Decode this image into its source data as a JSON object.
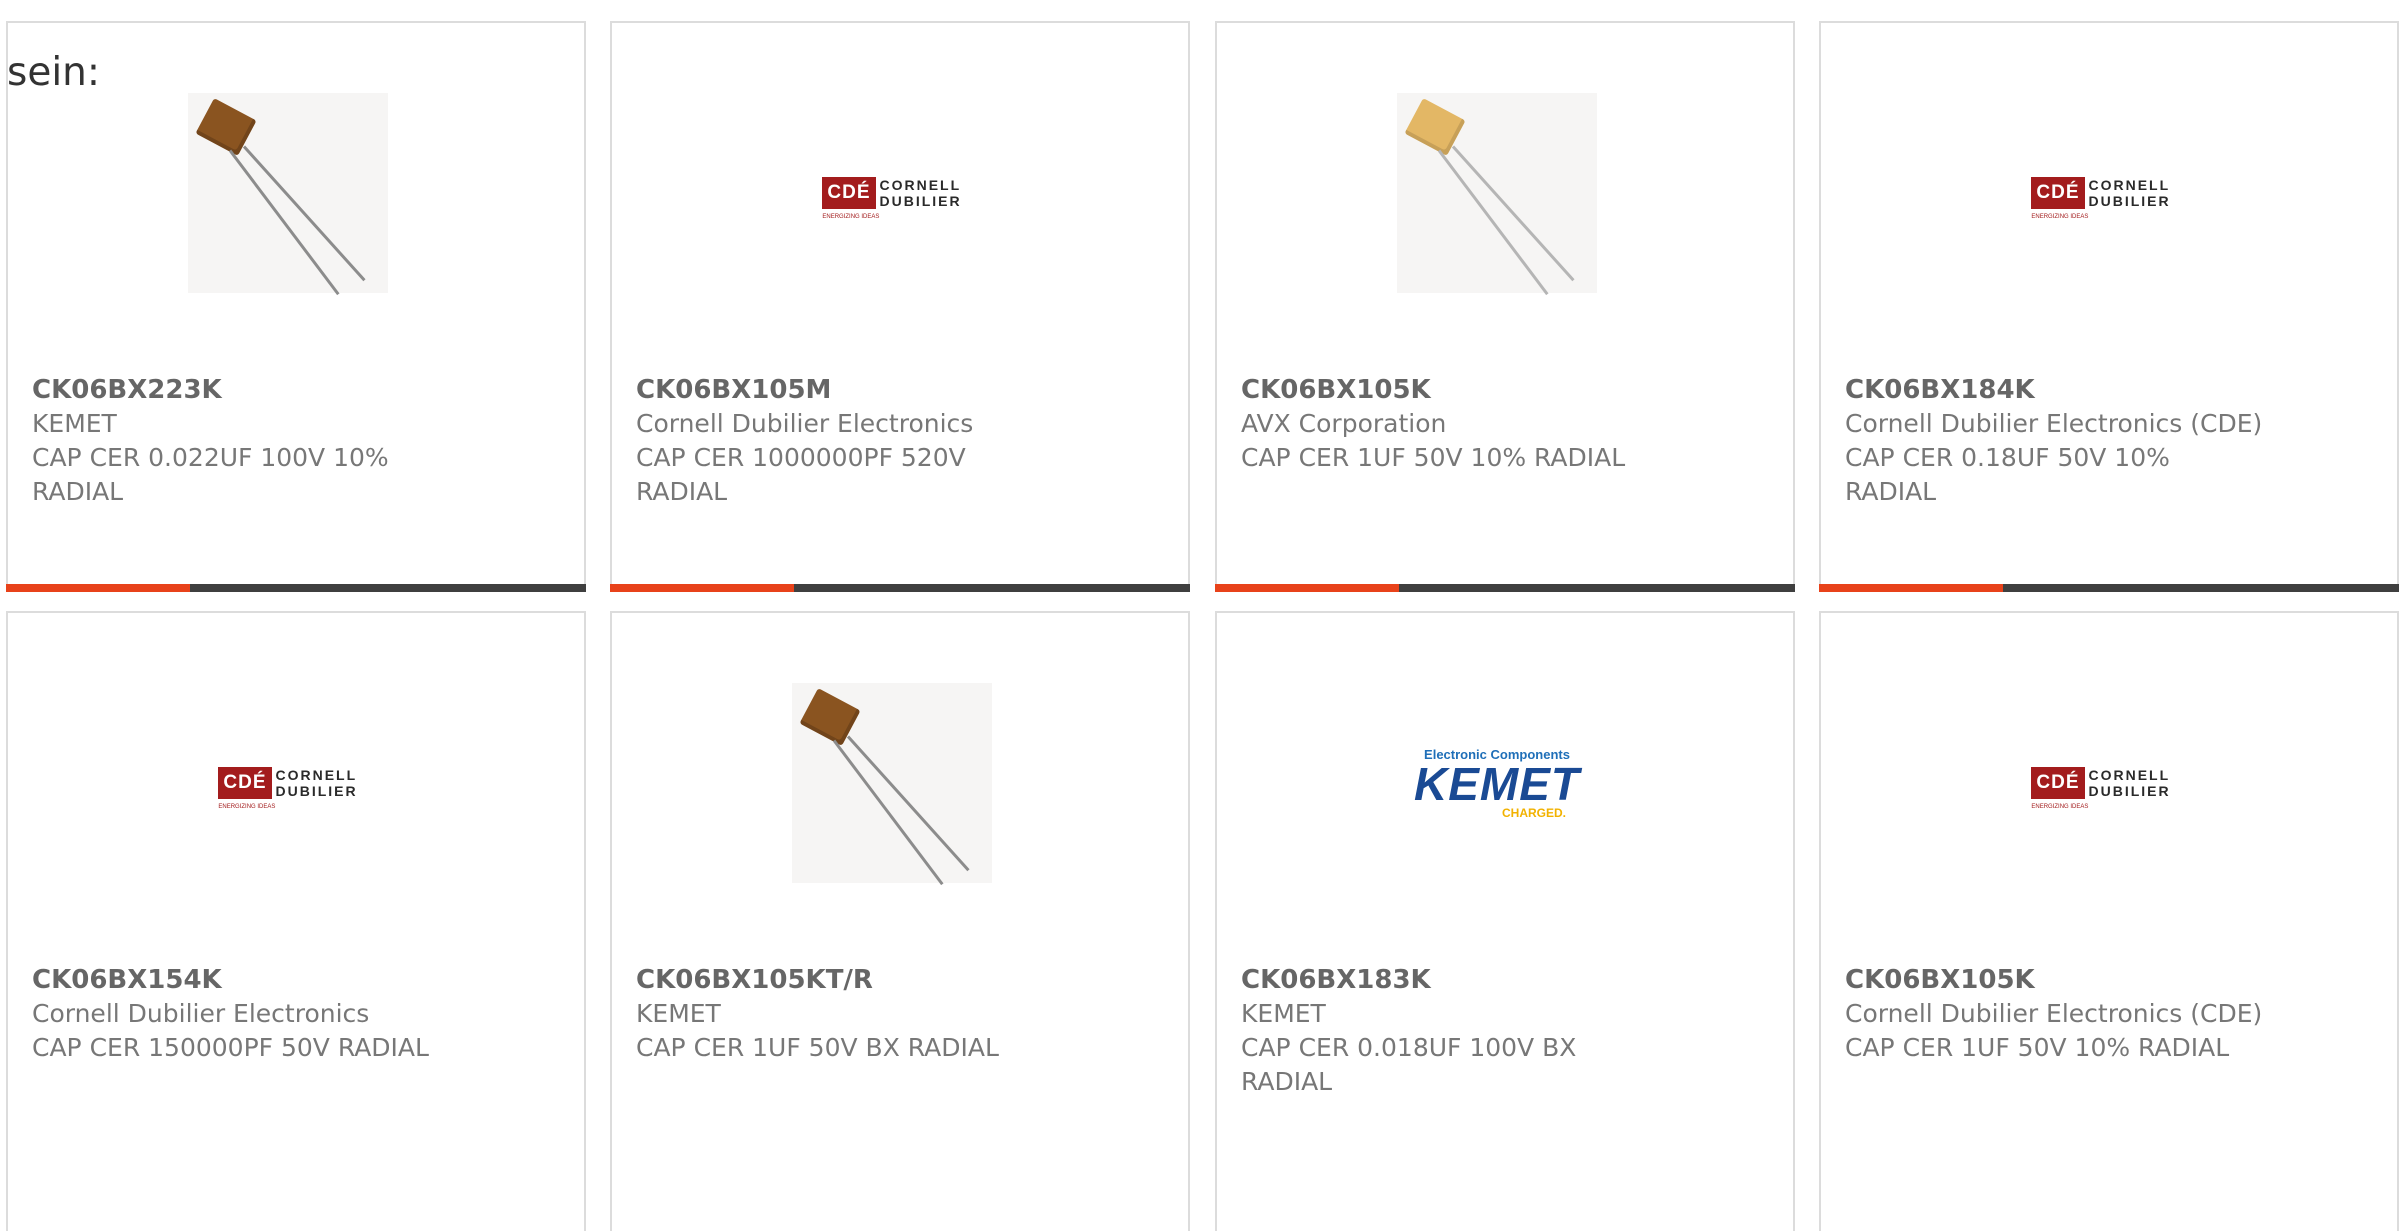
{
  "intro_text": "sein:",
  "accent_color": "#e8421a",
  "products": [
    {
      "part": "CK06BX223K",
      "manufacturer": "KEMET",
      "description": "CAP CER 0.022UF 100V 10% RADIAL",
      "image": "brown-capacitor-photo"
    },
    {
      "part": "CK06BX105M",
      "manufacturer": "Cornell Dubilier Electronics",
      "description": "CAP CER 1000000PF 520V RADIAL",
      "image": "cde-logo"
    },
    {
      "part": "CK06BX105K",
      "manufacturer": "AVX Corporation",
      "description": "CAP CER 1UF 50V 10% RADIAL",
      "image": "yellow-capacitor-photo"
    },
    {
      "part": "CK06BX184K",
      "manufacturer": "Cornell Dubilier Electronics (CDE)",
      "description": "CAP CER 0.18UF 50V 10% RADIAL",
      "image": "cde-logo"
    },
    {
      "part": "CK06BX154K",
      "manufacturer": "Cornell Dubilier Electronics",
      "description": "CAP CER 150000PF 50V RADIAL",
      "image": "cde-logo"
    },
    {
      "part": "CK06BX105KT/R",
      "manufacturer": "KEMET",
      "description": "CAP CER 1UF 50V BX RADIAL",
      "image": "brown-capacitor-photo"
    },
    {
      "part": "CK06BX183K",
      "manufacturer": "KEMET",
      "description": "CAP CER 0.018UF 100V BX RADIAL",
      "image": "kemet-logo"
    },
    {
      "part": "CK06BX105K",
      "manufacturer": "Cornell Dubilier Electronics (CDE)",
      "description": "CAP CER 1UF 50V 10% RADIAL",
      "image": "cde-logo"
    }
  ],
  "logos": {
    "cde_letters": "CDÉ",
    "cde_line1": "CORNELL",
    "cde_line2": "DUBILIER",
    "cde_tagline": "ENERGIZING IDEAS",
    "kemet_top": "Electronic Components",
    "kemet_word": "KEMET",
    "kemet_bottom": "CHARGED."
  }
}
